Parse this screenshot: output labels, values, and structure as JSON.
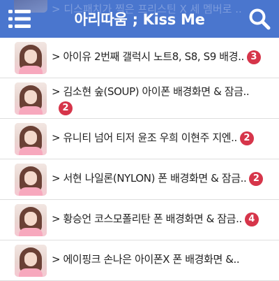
{
  "header": {
    "title": "아리따움 ; Kiss Me",
    "menu_icon": "hamburger-menu-icon",
    "search_icon": "search-icon",
    "background_color": "#4a76ce",
    "partial_row_text": "> 디스패치가 찍은 프리스틴 X 세 멤버로 .."
  },
  "accent": {
    "badge_color": "#d6354a"
  },
  "posts": [
    {
      "title": "> 아이유 2번째 갤럭시 노트8, S8, S9 배경..",
      "comments": "3"
    },
    {
      "title": "> 김소현 숲(SOUP) 아이폰 배경화면 & 잠금..",
      "comments": "2"
    },
    {
      "title": "> 유니티 넘어 티저 윤조 우희 이현주 지엔..",
      "comments": "2"
    },
    {
      "title": "> 서현 나일론(NYLON) 폰 배경화면 & 잠금..",
      "comments": "2"
    },
    {
      "title": "> 황승언 코스모폴리탄 폰 배경화면 & 잠금..",
      "comments": "4"
    },
    {
      "title": "> 에이핑크 손나은 아이폰X 폰 배경화면 &..",
      "comments": ""
    }
  ]
}
